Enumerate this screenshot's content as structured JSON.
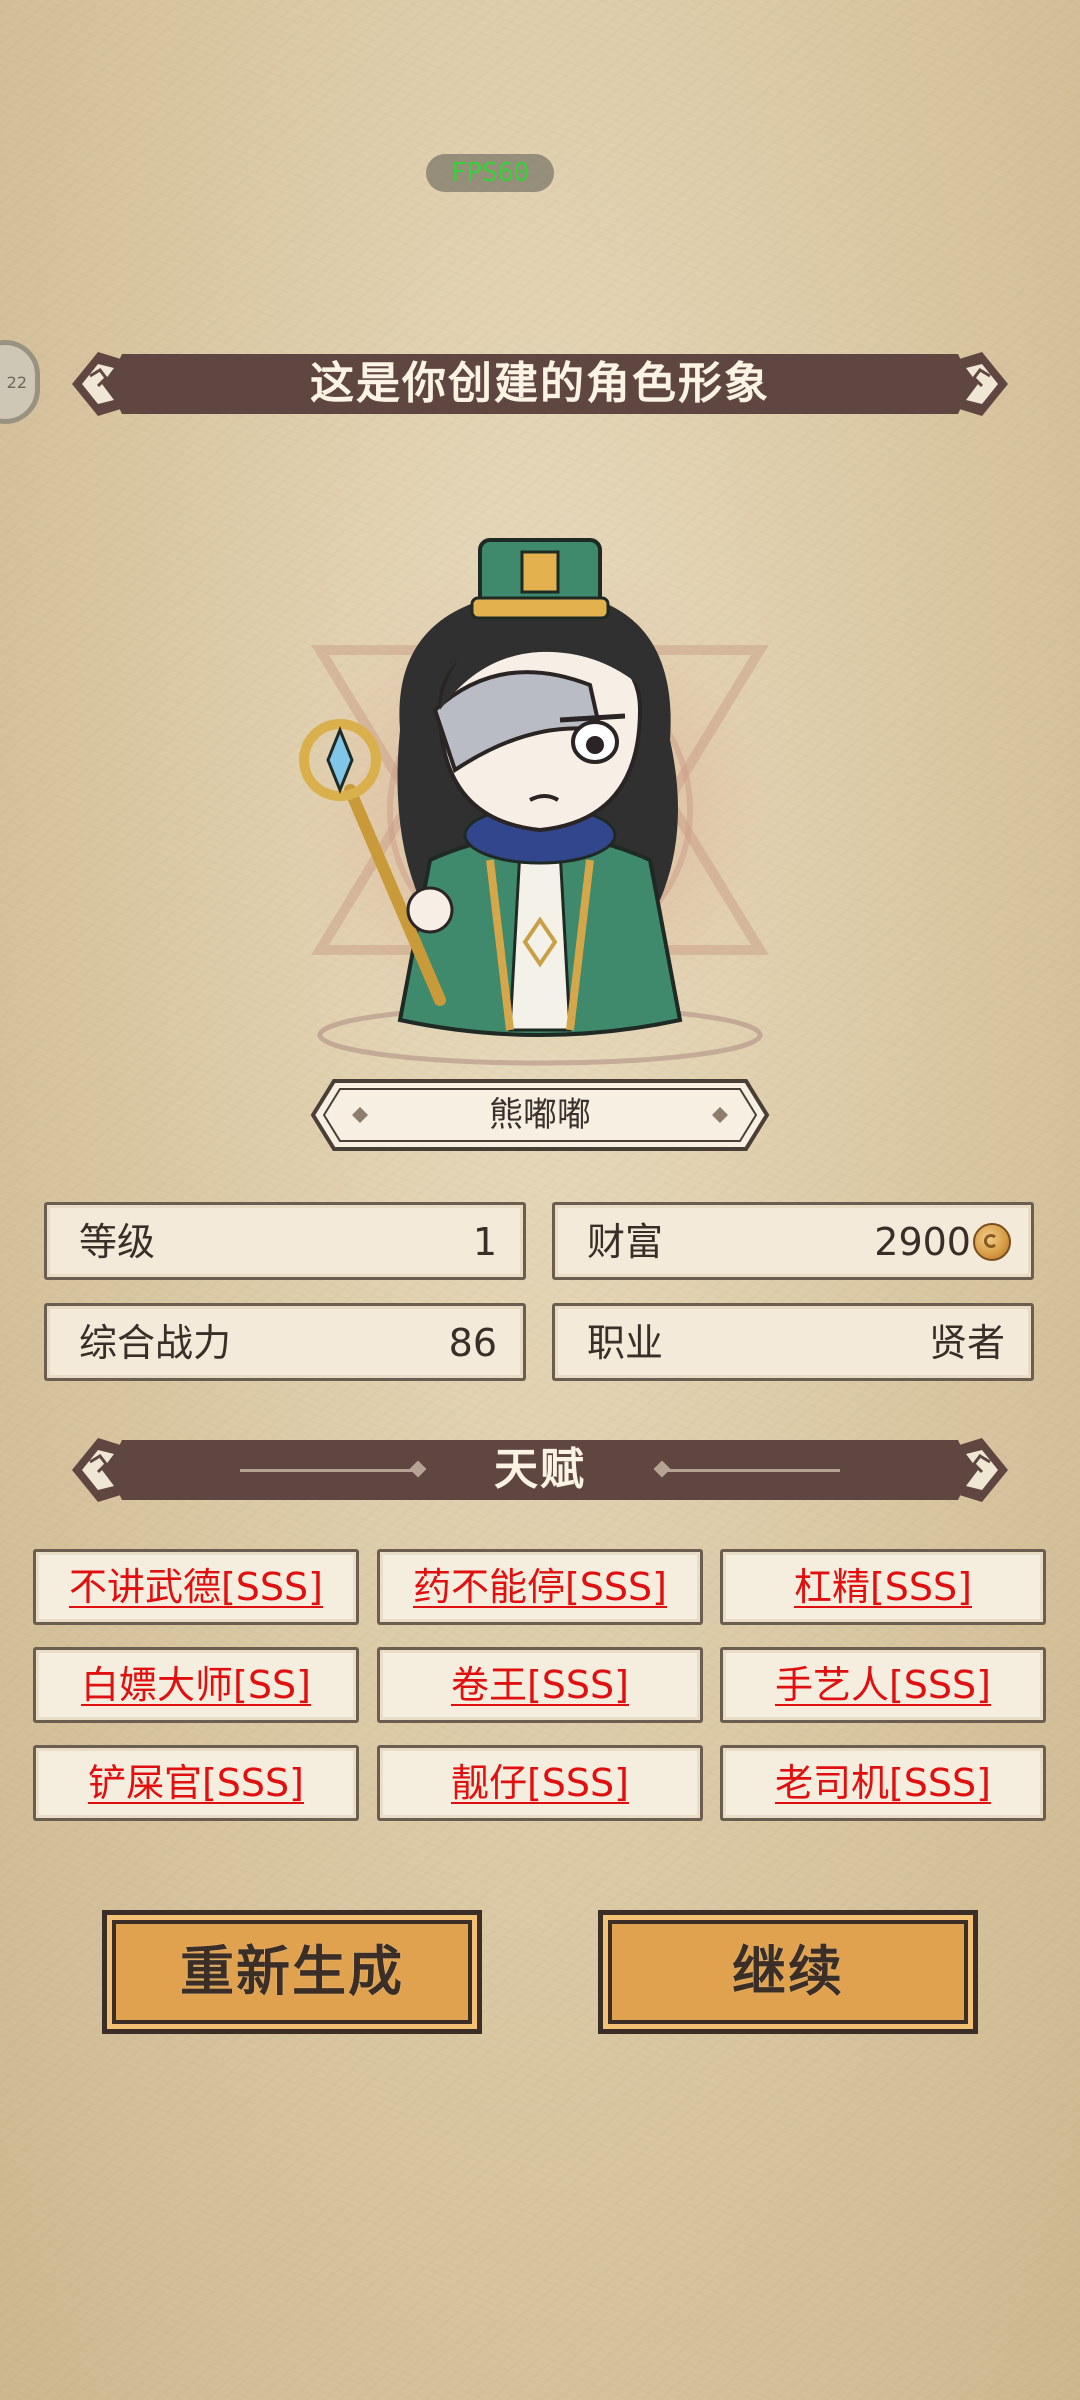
{
  "fps": "FPS60",
  "side_badge": "22",
  "title": "这是你创建的角色形象",
  "character_name": "熊嘟嘟",
  "stats": [
    {
      "label": "等级",
      "value": "1"
    },
    {
      "label": "财富",
      "value": "2900"
    },
    {
      "label": "综合战力",
      "value": "86"
    },
    {
      "label": "职业",
      "value": "贤者"
    }
  ],
  "talents_header": "天赋",
  "talents": [
    "不讲武德[SSS]",
    "药不能停[SSS]",
    "杠精[SSS]",
    "白嫖大师[SS]",
    "卷王[SSS]",
    "手艺人[SSS]",
    "铲屎官[SSS]",
    "靓仔[SSS]",
    "老司机[SSS]"
  ],
  "buttons": {
    "regenerate": "重新生成",
    "continue": "继续"
  },
  "colors": {
    "banner": "#5f4640",
    "talent_text": "#e01010",
    "button": "#e0a24e",
    "fps": "#39d139"
  }
}
